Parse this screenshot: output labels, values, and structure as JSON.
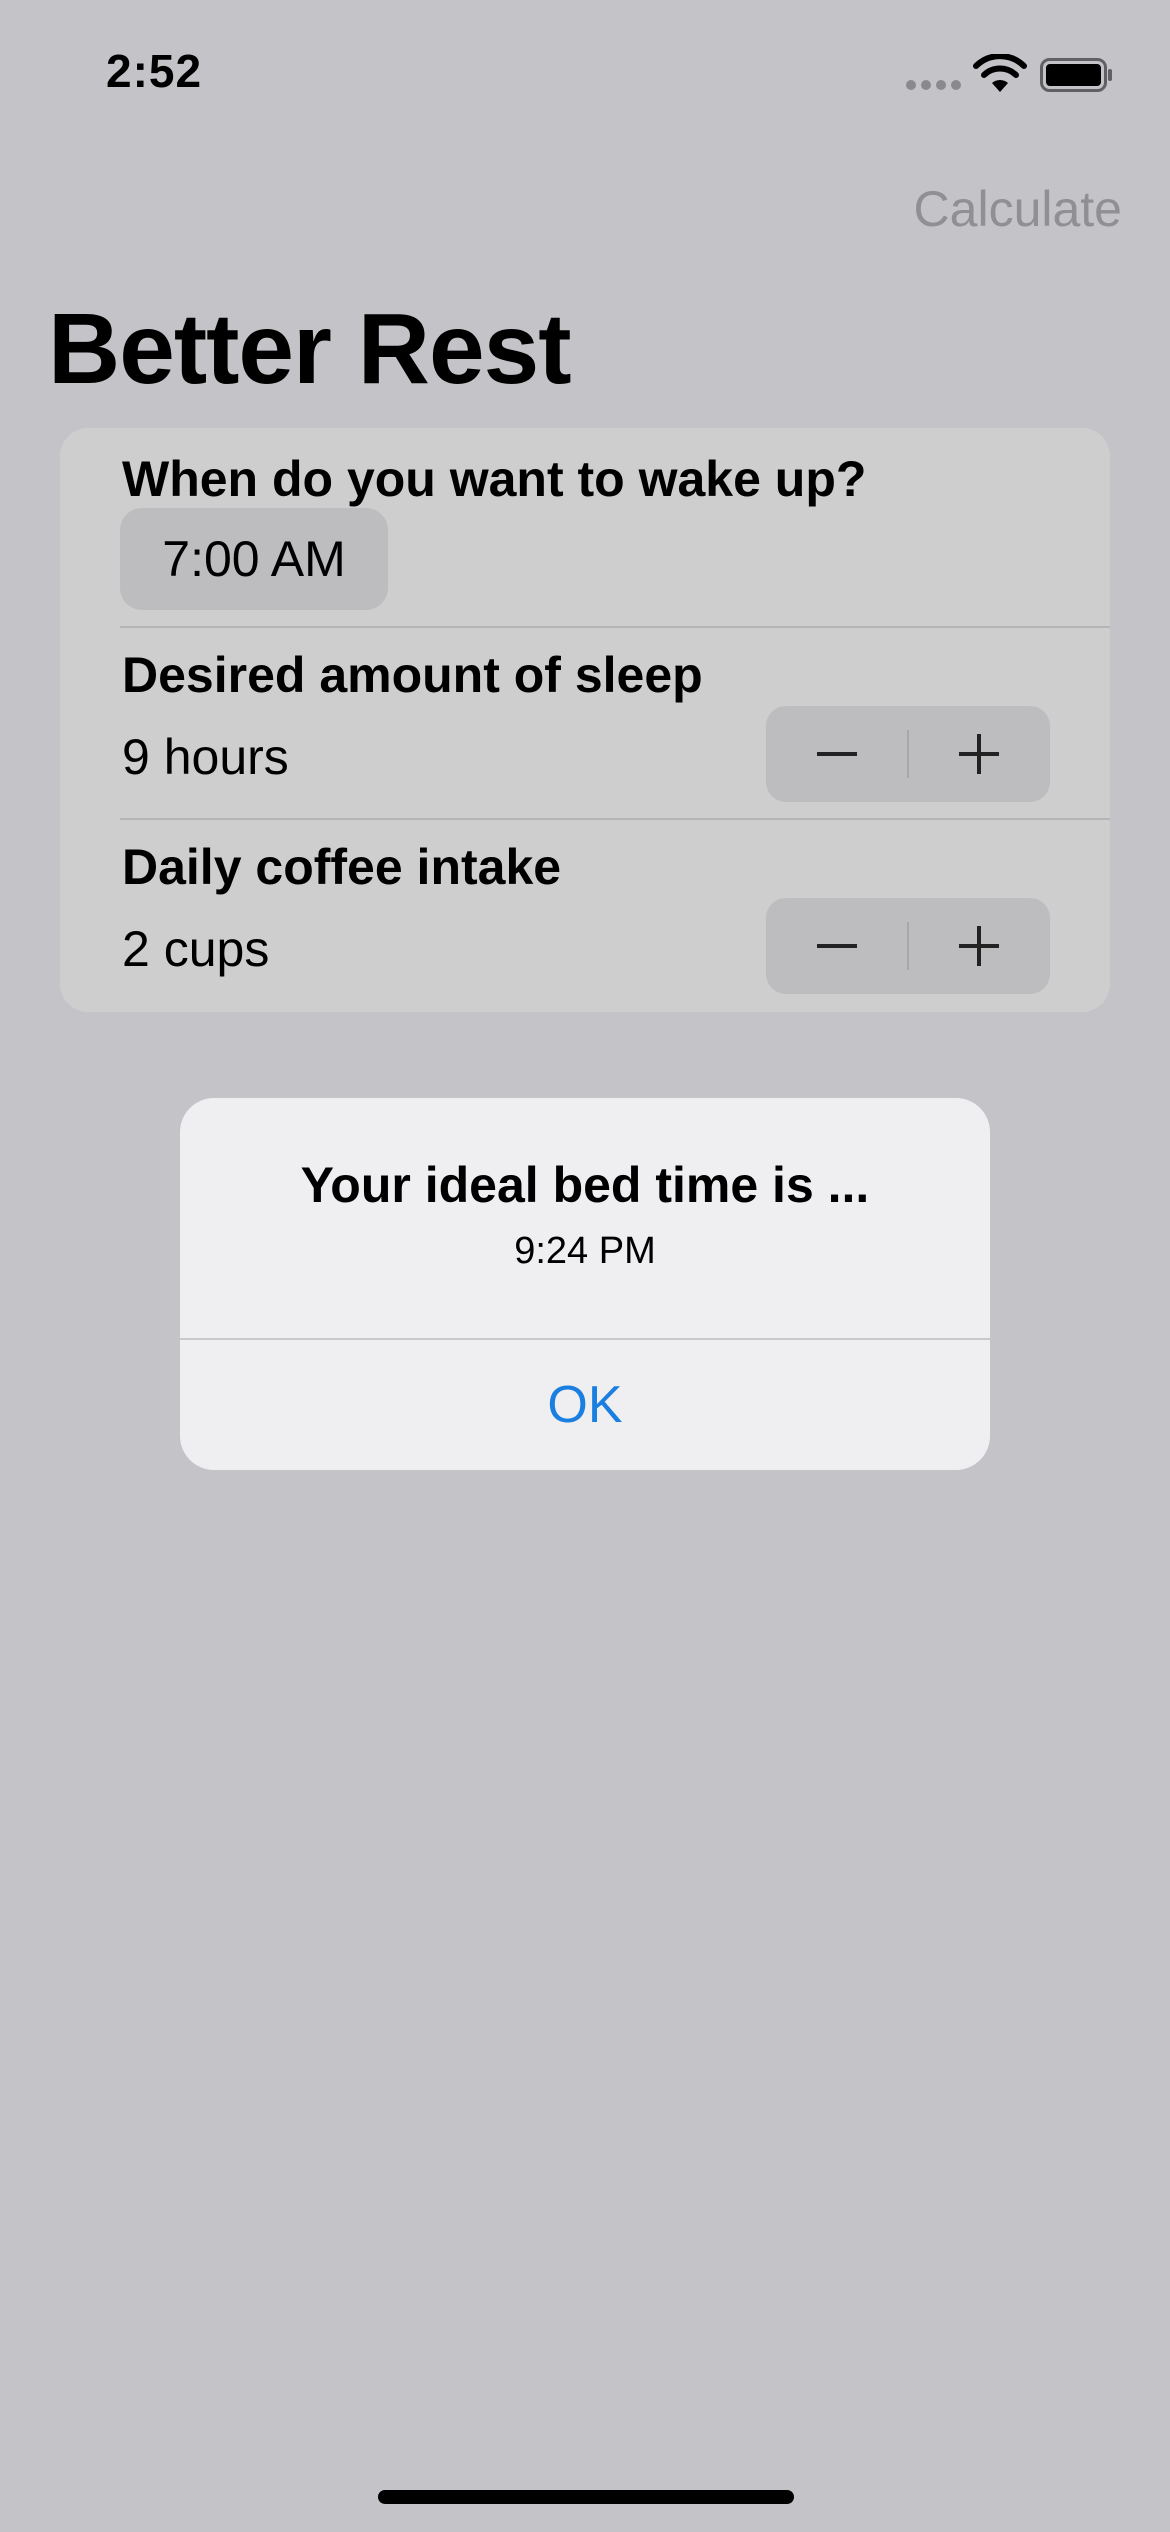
{
  "status_bar": {
    "time": "2:52"
  },
  "nav": {
    "calculate_label": "Calculate",
    "title": "Better Rest"
  },
  "form": {
    "wake_up": {
      "label": "When do you want to wake up?",
      "value": "7:00 AM"
    },
    "sleep": {
      "label": "Desired amount of sleep",
      "value": "9 hours"
    },
    "coffee": {
      "label": "Daily coffee intake",
      "value": "2 cups"
    }
  },
  "alert": {
    "title": "Your ideal bed time is ...",
    "message": "9:24 PM",
    "ok_label": "OK"
  },
  "colors": {
    "background": "#c3c3c8",
    "card": "#cececf",
    "alert_background": "#efeff2",
    "accent_blue": "#1a7fe0",
    "disabled_gray": "#8f8f94"
  },
  "icons": {
    "signal": "cellular-signal-icon",
    "wifi": "wifi-icon",
    "battery": "battery-icon",
    "stepper_minus": "minus-icon",
    "stepper_plus": "plus-icon"
  }
}
